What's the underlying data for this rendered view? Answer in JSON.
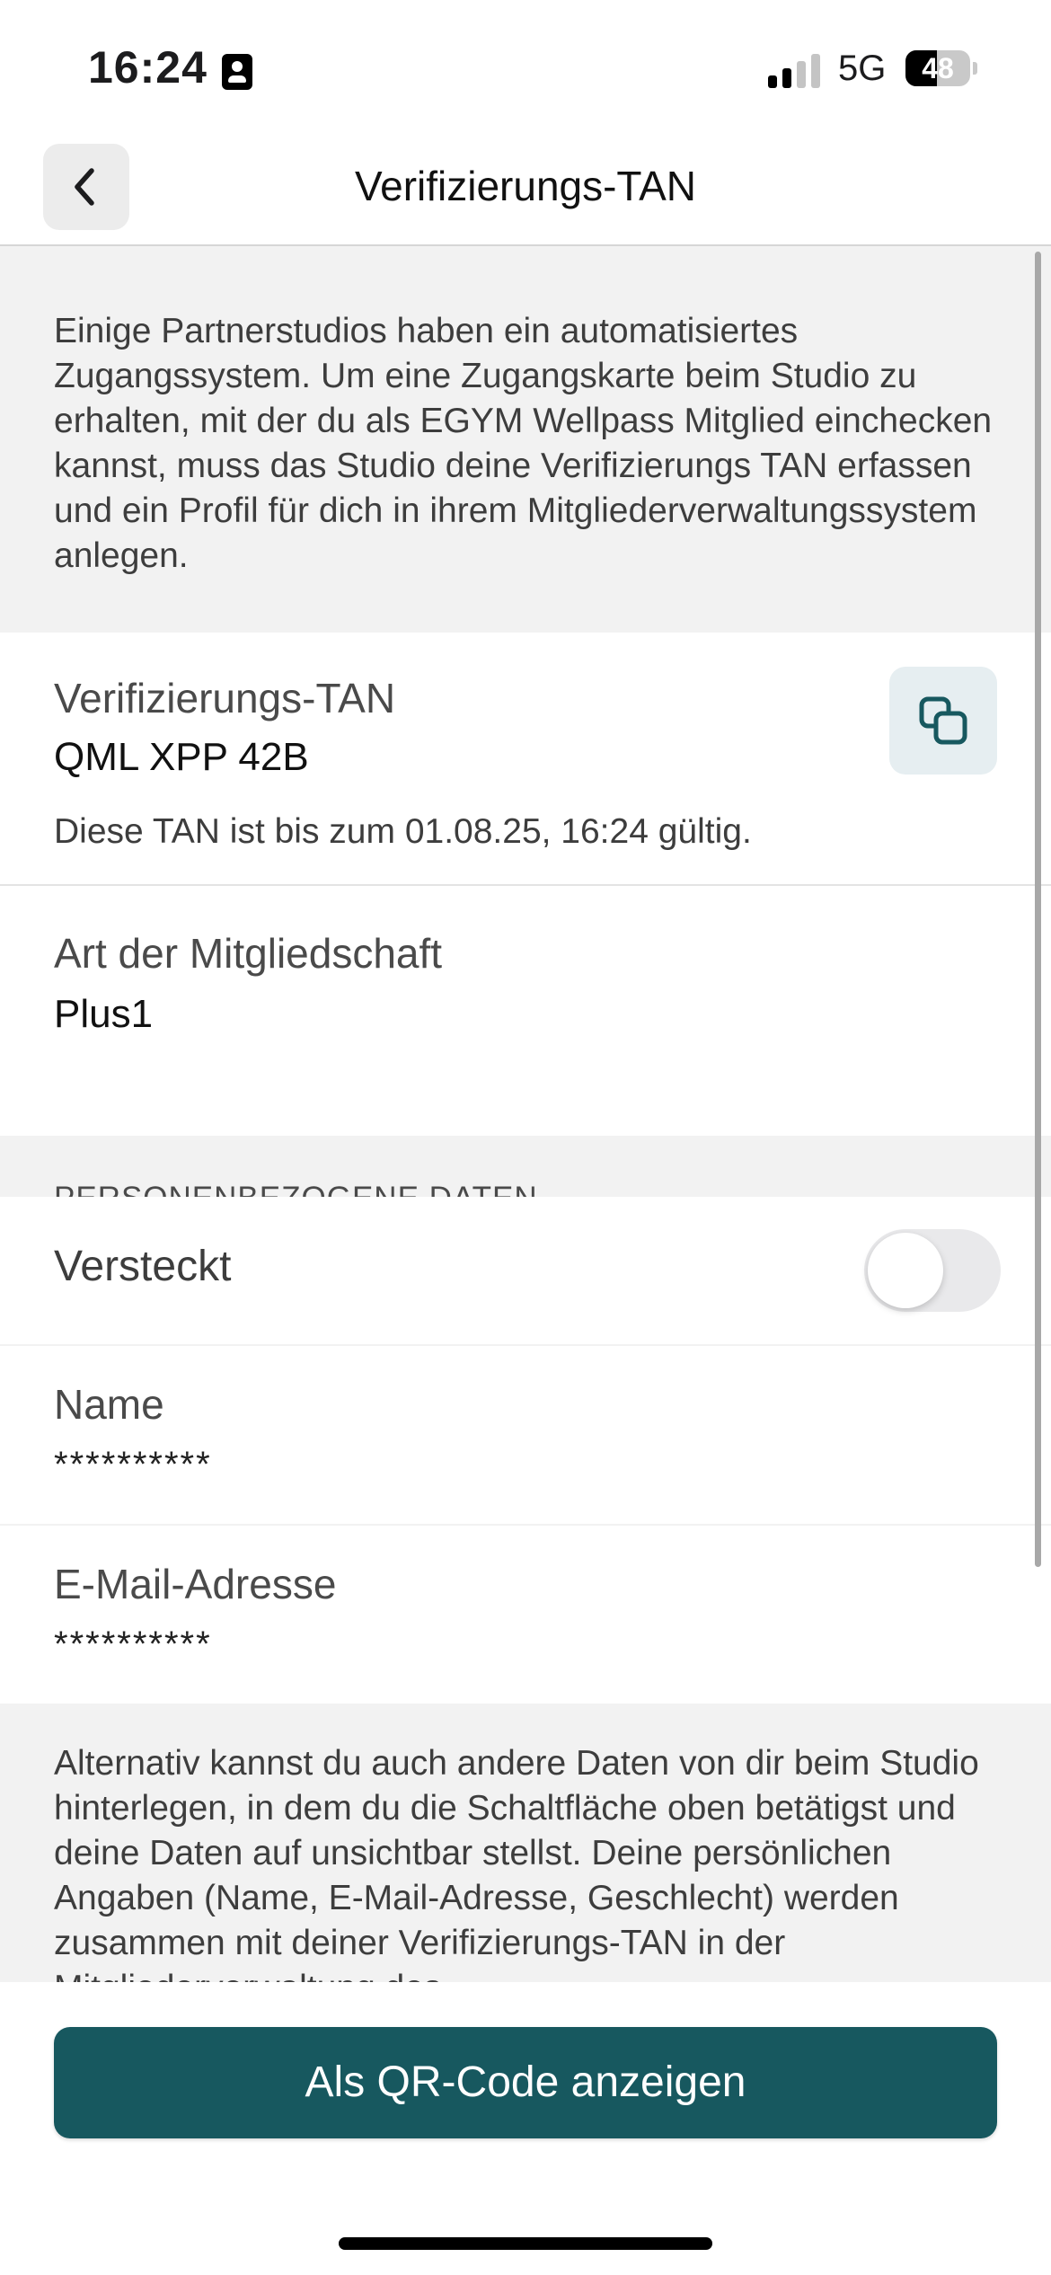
{
  "status_bar": {
    "time": "16:24",
    "network": "5G",
    "battery_level": "48",
    "battery_fraction": 0.48,
    "signal_bars_active": 2,
    "signal_bars_total": 4
  },
  "nav": {
    "title": "Verifizierungs-TAN",
    "back_icon": "chevron-left-icon"
  },
  "info": {
    "text": "Einige Partnerstudios haben ein automatisiertes Zugangssystem. Um eine Zugangskarte beim Studio zu erhalten, mit der du als EGYM Wellpass Mitglied einchecken kannst, muss das Studio deine Verifizierungs TAN erfassen und ein Profil für dich in ihrem Mitgliederverwaltungssystem anlegen."
  },
  "tan": {
    "label": "Verifizierungs-TAN",
    "value": "QML XPP 42B",
    "validity": "Diese TAN ist bis zum 01.08.25, 16:24 gültig.",
    "copy_icon": "copy-icon"
  },
  "membership": {
    "label": "Art der Mitgliedschaft",
    "value": "Plus1"
  },
  "personal": {
    "header": "PERSONENBEZOGENE DATEN",
    "hidden_label": "Versteckt",
    "hidden_on": false,
    "name_label": "Name",
    "name_value": "**********",
    "email_label": "E-Mail-Adresse",
    "email_value": "**********"
  },
  "alt": {
    "text": "Alternativ kannst du auch andere Daten von dir beim Studio hinterlegen, in dem du die Schaltfläche oben betätigst und deine Daten auf unsichtbar stellst. Deine persönlichen Angaben (Name, E-Mail-Adresse, Geschlecht) werden zusammen mit deiner Verifizierungs-TAN in der Mitgliederverwaltung des"
  },
  "actions": {
    "qr_button": "Als QR-Code anzeigen"
  },
  "colors": {
    "accent": "#17585f",
    "copy_bg": "#e6eef1",
    "background_gray": "#f2f2f2"
  }
}
